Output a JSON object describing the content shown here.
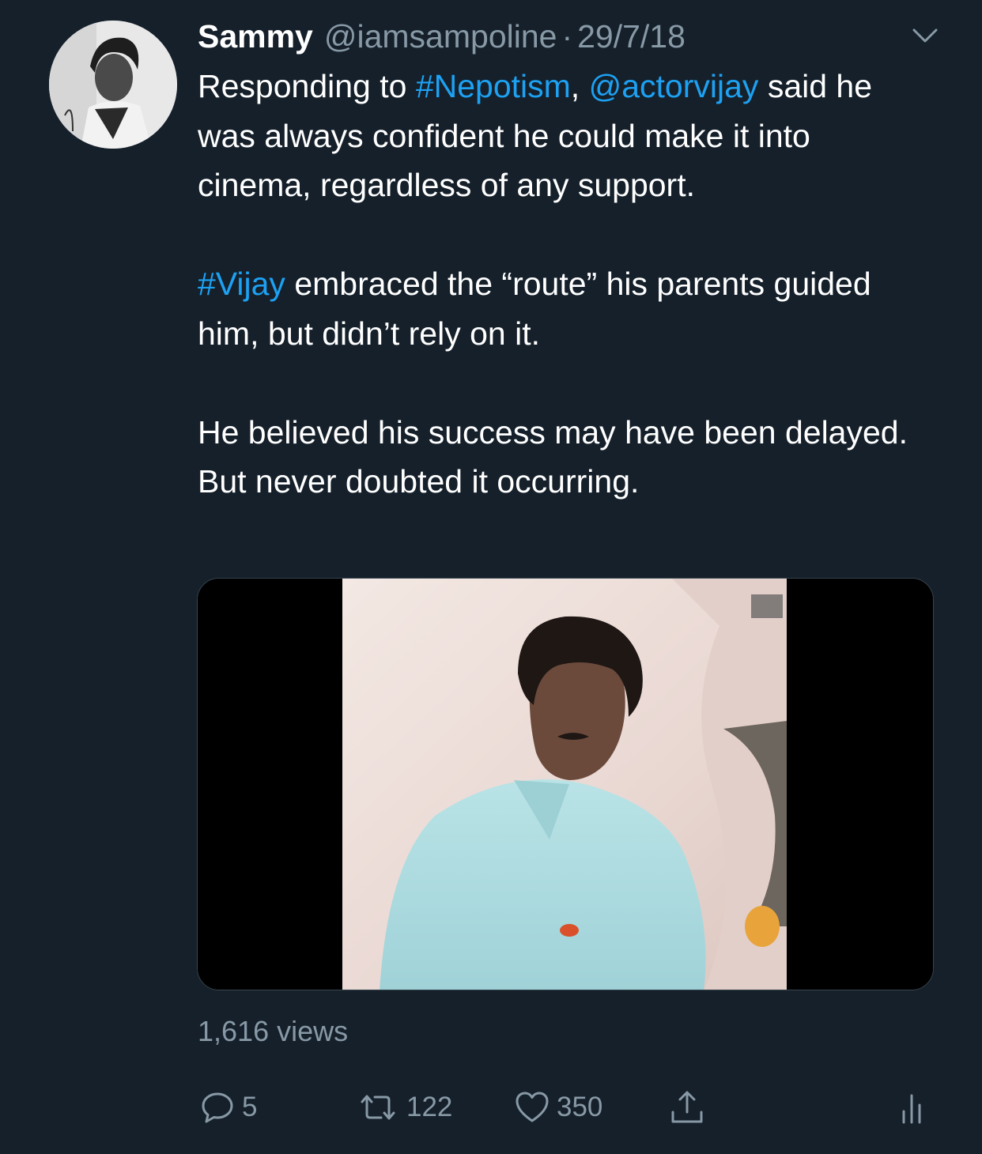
{
  "tweet": {
    "author_name": "Sammy",
    "handle": "@iamsampoline",
    "separator": "·",
    "date": "29/7/18",
    "menu_icon": "chevron-down-icon",
    "text": {
      "p1_prefix": "Responding to ",
      "hashtag_nepotism": "#Nepotism",
      "comma": ",",
      "mention_actorvijay": "@actorvijay",
      "p1_rest": "said he was always confident he could make it into cinema, regardless of any support.",
      "hashtag_vijay": "#Vijay",
      "p2_rest": " embraced the “route” his parents guided him, but didn’t rely on it.",
      "p3": "He believed his success may have been delayed. But never doubted it occurring."
    },
    "media": {
      "type": "video",
      "views": "1,616 views"
    },
    "actions": {
      "reply_count": "5",
      "retweet_count": "122",
      "like_count": "350",
      "icons": [
        "reply-icon",
        "retweet-icon",
        "like-icon",
        "share-icon",
        "analytics-icon"
      ]
    },
    "colors": {
      "background": "#15202b",
      "link": "#1da1f2",
      "secondary_text": "#8899a6",
      "primary_text": "#ffffff"
    }
  }
}
